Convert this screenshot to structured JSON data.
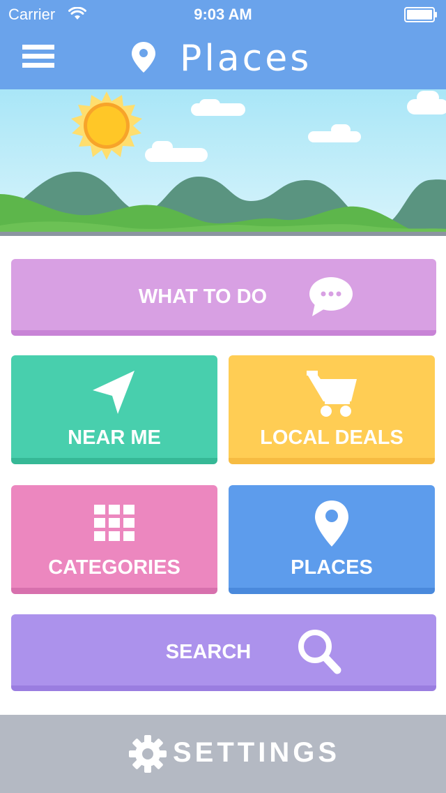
{
  "status_bar": {
    "carrier": "Carrier",
    "time": "9:03 AM",
    "icons": [
      "wifi-icon",
      "battery-icon"
    ]
  },
  "nav": {
    "title": "Places",
    "menu_icon": "hamburger-menu-icon",
    "title_icon": "map-pin-icon"
  },
  "tiles": {
    "what_to_do": {
      "label": "WHAT TO DO",
      "icon": "chat-bubble-icon",
      "color": "#d8a0e3"
    },
    "near_me": {
      "label": "NEAR ME",
      "icon": "location-arrow-icon",
      "color": "#48cfad"
    },
    "local_deals": {
      "label": "LOCAL DEALS",
      "icon": "shopping-cart-icon",
      "color": "#ffcd54"
    },
    "categories": {
      "label": "CATEGORIES",
      "icon": "grid-icon",
      "color": "#ec87bf"
    },
    "places": {
      "label": "PLACES",
      "icon": "map-pin-icon",
      "color": "#5d9cec"
    },
    "search": {
      "label": "SEARCH",
      "icon": "search-icon",
      "color": "#ac92ec"
    }
  },
  "footer": {
    "label": "SETTINGS",
    "icon": "gear-icon",
    "color": "#b4b9c3"
  },
  "colors": {
    "header": "#6aa3eb",
    "sky": "#b6ecfa",
    "sun": "#ffc727"
  }
}
